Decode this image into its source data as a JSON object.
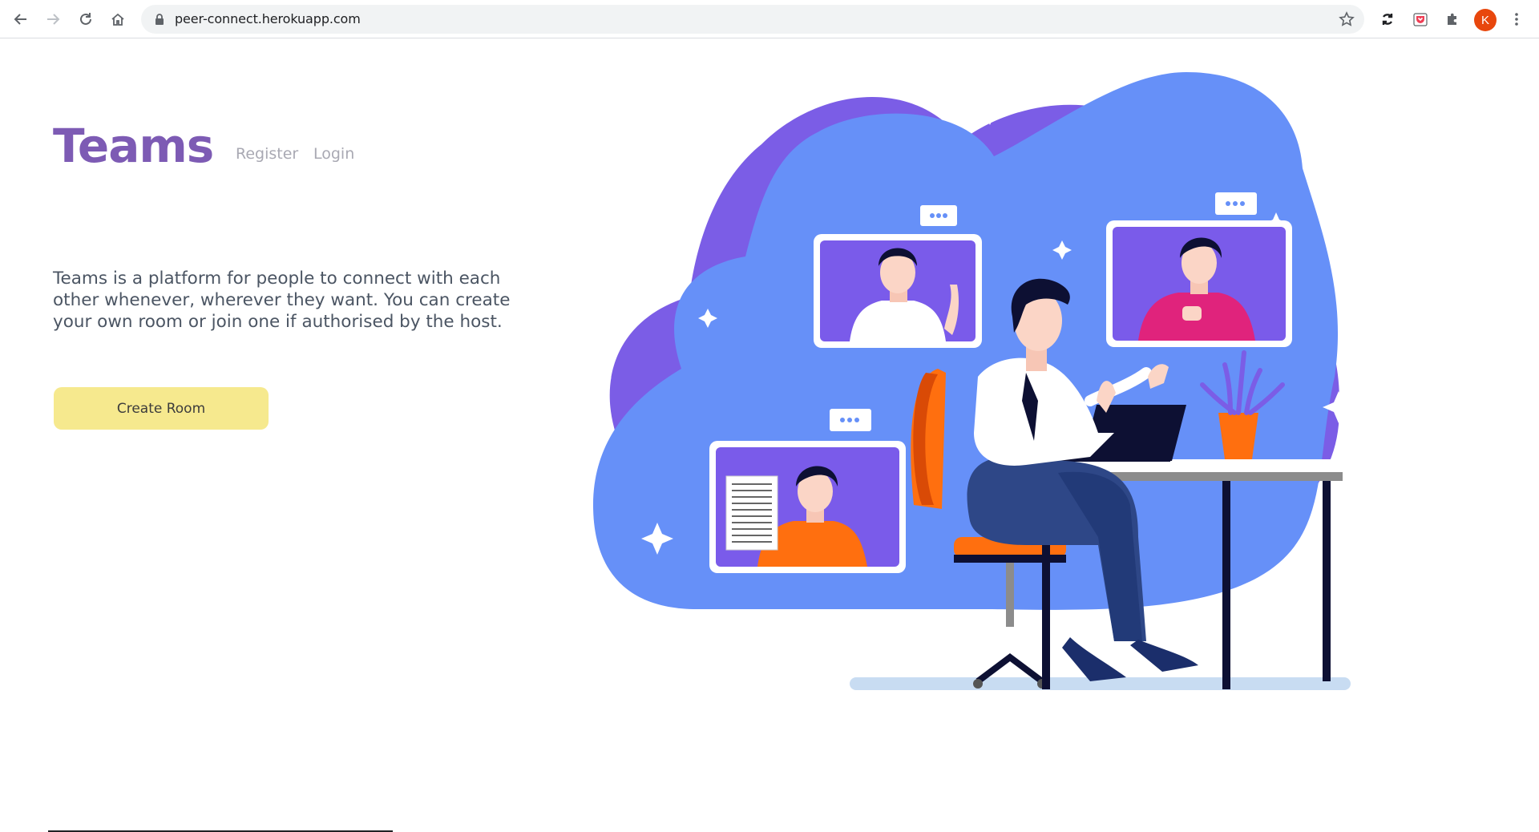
{
  "browser": {
    "url": "peer-connect.herokuapp.com",
    "profile_initial": "K",
    "icons": [
      "back-arrow-icon",
      "forward-arrow-icon",
      "reload-icon",
      "home-icon",
      "lock-icon",
      "bookmark-star-icon",
      "sync-icon",
      "pocket-extension-icon",
      "extensions-puzzle-icon",
      "menu-dots-icon"
    ]
  },
  "header": {
    "brand": "Teams",
    "nav": {
      "register": "Register",
      "login": "Login"
    }
  },
  "hero": {
    "description": "Teams is a platform for people to connect with each other whenever, wherever they want. You can create your own room or join one if authorised by the host.",
    "cta_label": "Create Room"
  },
  "illustration": {
    "subject": "video-conference-illustration",
    "colors": {
      "blob_blue": "#6a8ff7",
      "blob_purple": "#7b5de6",
      "chair": "#f05a0e",
      "screen_purple": "#7a5bea"
    }
  }
}
